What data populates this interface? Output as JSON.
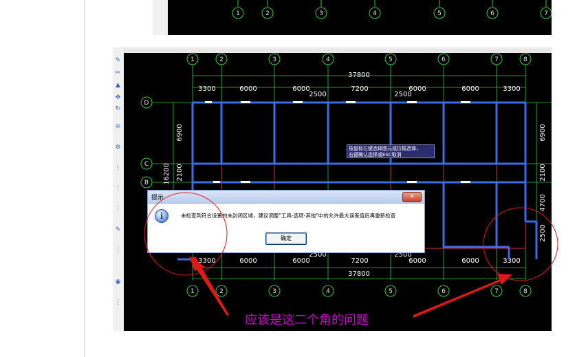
{
  "axis_labels_top": [
    "1",
    "2",
    "3",
    "4",
    "5",
    "6",
    "7"
  ],
  "axis_labels_main": [
    "1",
    "2",
    "3",
    "4",
    "5",
    "6",
    "7",
    "8"
  ],
  "row_labels": [
    "D",
    "C",
    "B"
  ],
  "dims": {
    "total": "37800",
    "top_row": [
      "3300",
      "6000",
      "6000",
      "7200",
      "6000",
      "6000",
      "3300"
    ],
    "mid_row": [
      "2500",
      "2500"
    ],
    "bottom_row": [
      "3300",
      "6000",
      "6000",
      "7200",
      "6000",
      "6000",
      "3300"
    ],
    "bottom_mid": [
      "2500",
      "2500"
    ],
    "bottom_total": "37800",
    "left_vertical": [
      "6900",
      "2100",
      "16200"
    ],
    "right_vertical": [
      "6900",
      "2100",
      "4700",
      "2500"
    ]
  },
  "tooltip": {
    "line1": "按鼠标左键选择图元或拉框选择，",
    "line2": "右键确认选择或ESC取消"
  },
  "dialog": {
    "title": "提示",
    "close": "✕",
    "message": "未检查到符合设置的未封闭区域，建议调整\"工具-选项-其他\"中的允许最大误差值后再重新检查",
    "ok": "确定"
  },
  "annotation": "应该是这二个角的问题",
  "colors": {
    "cad_bg": "#000000",
    "axis_green": "#2ecc40",
    "wall_blue": "#3a6ee8",
    "wall_red": "#d0304a",
    "annotation_pink": "#cc00cc",
    "arrow_red": "#e01818"
  }
}
